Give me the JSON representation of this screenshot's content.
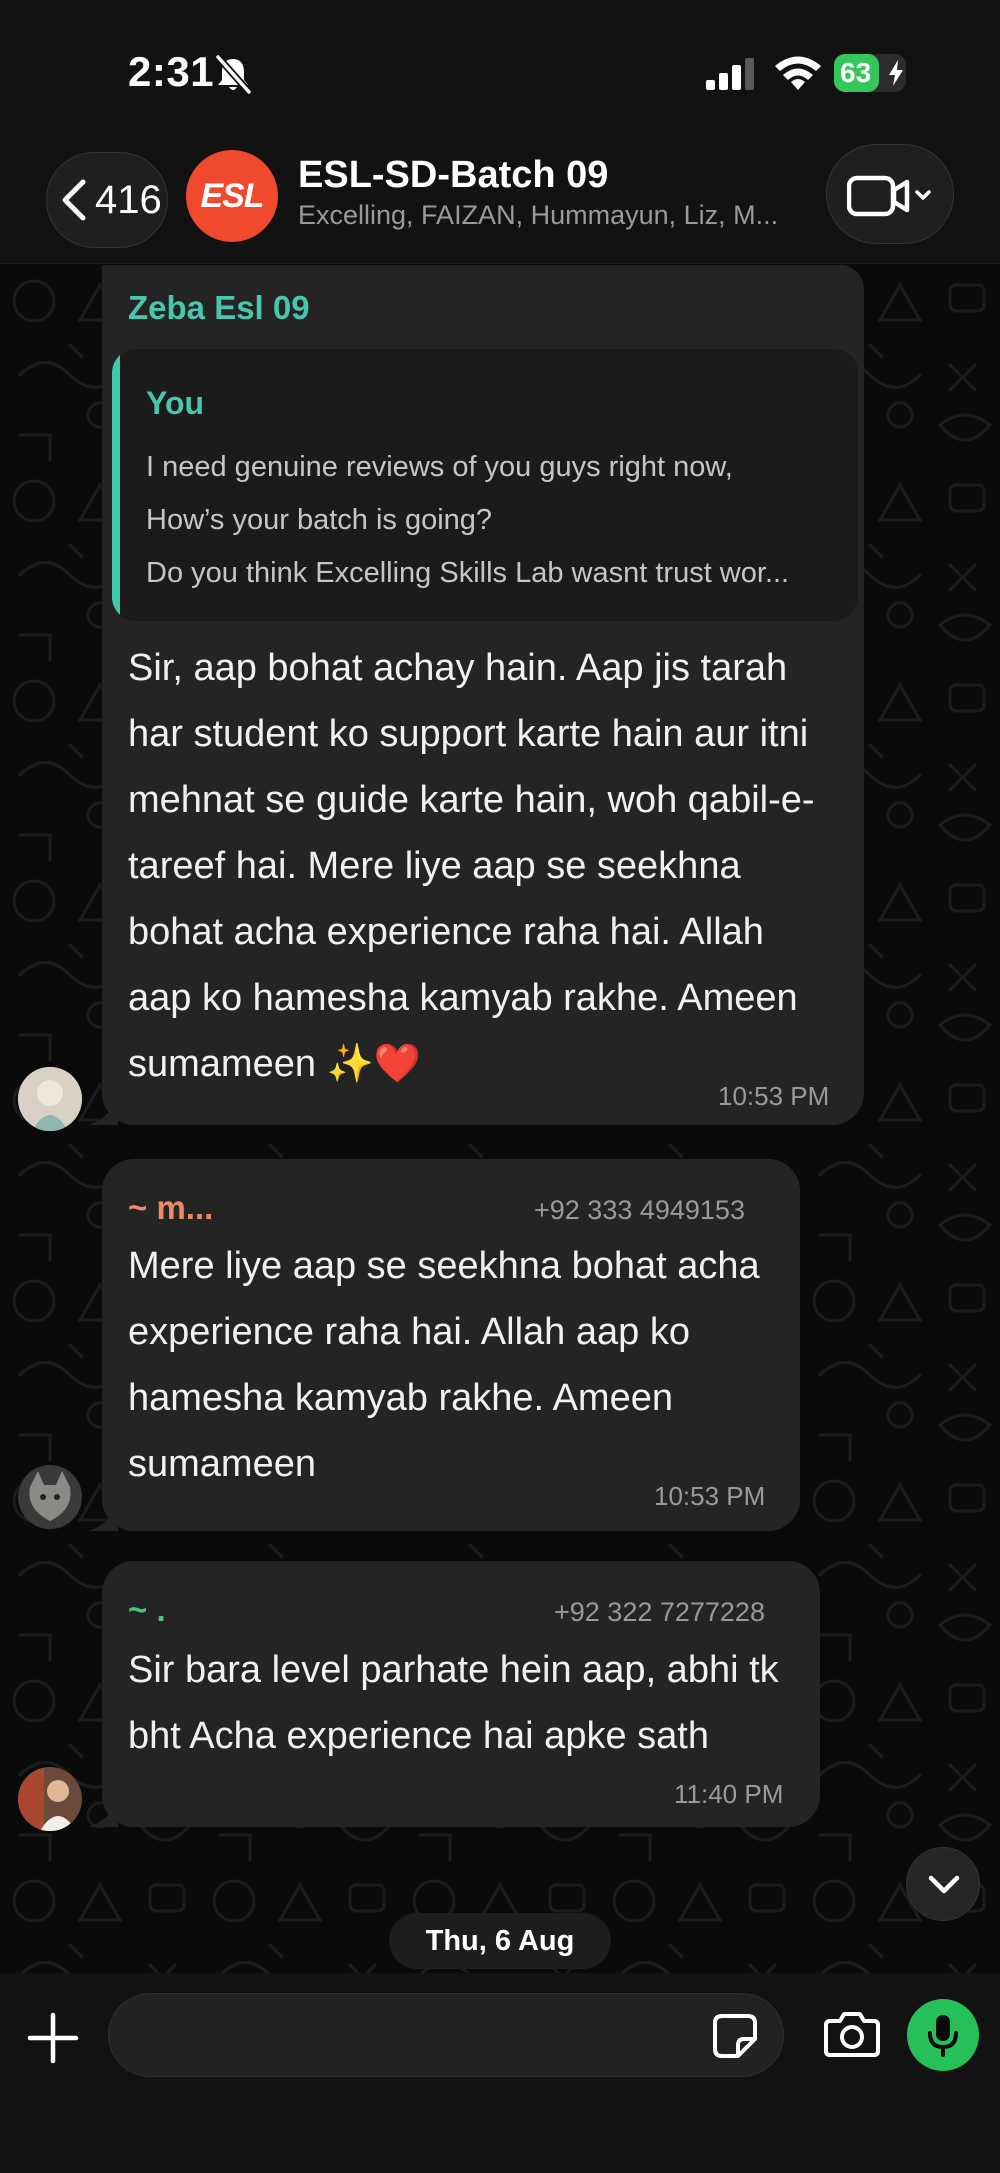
{
  "status_bar": {
    "time": "2:31",
    "battery": "63",
    "battery_level": 0.63
  },
  "header": {
    "back_count": "416",
    "avatar_text": "ESL",
    "title": "ESL-SD-Batch 09",
    "members": "Excelling, FAIZAN, Hummayun, Liz, M...",
    "accent": "#f0492d"
  },
  "messages": [
    {
      "sender": "Zeba Esl 09",
      "sender_color": "#48c6ae",
      "quote": {
        "author": "You",
        "lines": [
          "I need genuine reviews of you guys right now,",
          "How’s your batch is going?",
          "Do you think Excelling Skills Lab wasnt trust wor..."
        ]
      },
      "lines": [
        "Sir, aap bohat achay hain. Aap jis tarah",
        "har student ko support karte hain aur itni",
        "mehnat se guide karte hain, woh qabil-e-",
        "tareef hai. Mere liye aap se seekhna",
        "bohat acha experience raha hai. Allah",
        "aap ko hamesha kamyab rakhe. Ameen",
        "sumameen ✨❤️"
      ],
      "time": "10:53 PM"
    },
    {
      "sender": "~ m...",
      "sender_color": "#ee8a63",
      "phone": "+92 333 4949153",
      "lines": [
        "Mere liye aap se seekhna bohat acha",
        "experience raha hai. Allah aap ko",
        "hamesha kamyab rakhe. Ameen",
        "sumameen"
      ],
      "time": "10:53 PM"
    },
    {
      "sender": "~ .",
      "sender_color": "#4cc37a",
      "phone": "+92 322 7277228",
      "lines": [
        "Sir bara level parhate hein aap, abhi tk",
        "bht Acha experience hai apke sath"
      ],
      "time": "11:40 PM"
    }
  ],
  "date_chip": "Thu, 6 Aug",
  "composer": {
    "placeholder": ""
  },
  "icons": [
    "bell-slash-icon",
    "signal-icon",
    "wifi-icon",
    "battery-icon",
    "chevron-left-icon",
    "video-camera-icon",
    "chevron-down-icon",
    "plus-icon",
    "sticker-icon",
    "camera-icon",
    "microphone-icon"
  ]
}
